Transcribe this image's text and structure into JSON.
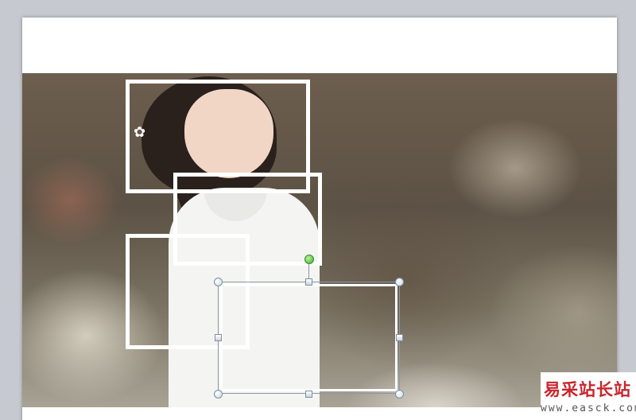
{
  "slide": {
    "background_color": "#ffffff",
    "photo_subject": "woman-portrait"
  },
  "frames": [
    {
      "name": "frame-top",
      "border_color": "#ffffff"
    },
    {
      "name": "frame-middle",
      "border_color": "#ffffff"
    },
    {
      "name": "frame-left",
      "border_color": "#ffffff"
    },
    {
      "name": "frame-selected",
      "border_color": "#ffffff",
      "selected": true
    }
  ],
  "selection": {
    "handle_color": "#c9d6e3",
    "rotate_handle_color": "#3fb52a"
  },
  "watermark": {
    "title": "易采站长站",
    "url": "www.easck.com",
    "title_color": "#c8252c"
  }
}
